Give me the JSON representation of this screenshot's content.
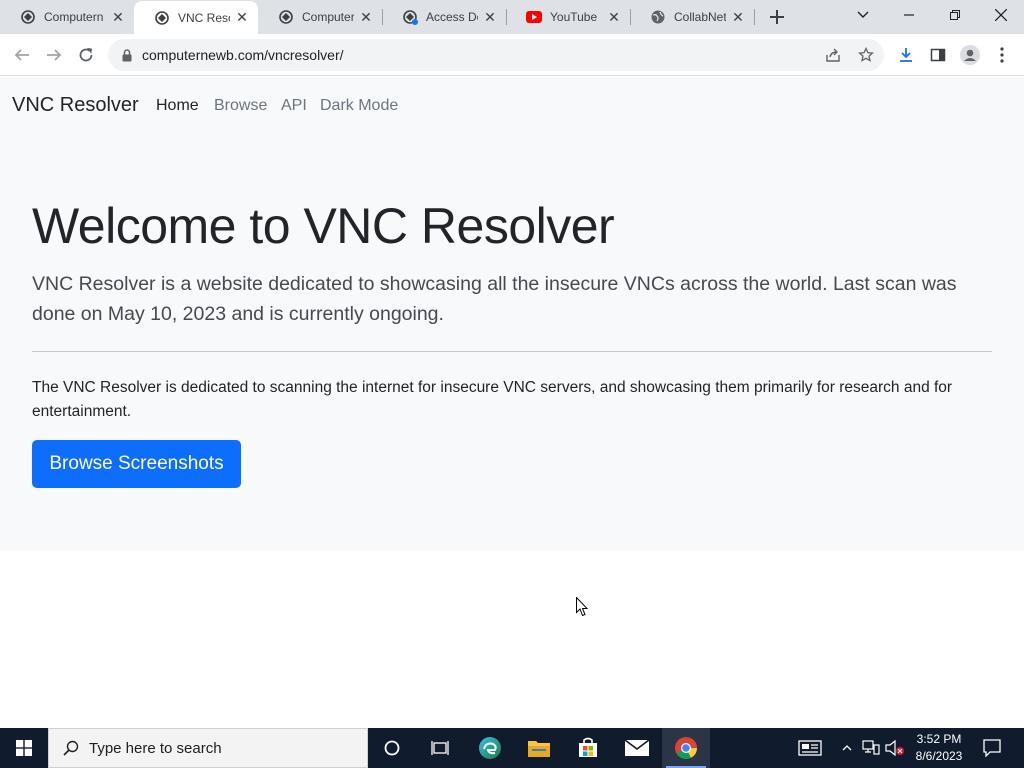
{
  "browser": {
    "tabs": [
      {
        "title": "Computern",
        "favicon": "computernewb-icon",
        "active": false
      },
      {
        "title": "VNC Resolv",
        "favicon": "computernewb-icon",
        "active": true
      },
      {
        "title": "Computern",
        "favicon": "computernewb-icon",
        "active": false
      },
      {
        "title": "Access Den",
        "favicon": "computernewb-icon",
        "active": false
      },
      {
        "title": "YouTube",
        "favicon": "youtube-icon",
        "active": false
      },
      {
        "title": "CollabNet",
        "favicon": "globe-icon",
        "active": false
      }
    ],
    "url": "computernewb.com/vncresolver/"
  },
  "site": {
    "brand": "VNC Resolver",
    "nav": {
      "home": "Home",
      "browse": "Browse",
      "api": "API",
      "dark_mode": "Dark Mode"
    },
    "title": "Welcome to VNC Resolver",
    "lead": "VNC Resolver is a website dedicated to showcasing all the insecure VNCs across the world. Last scan was done on May 10, 2023 and is currently ongoing.",
    "description": "The VNC Resolver is dedicated to scanning the internet for insecure VNC servers, and showcasing them primarily for research and for entertainment.",
    "button": "Browse Screenshots"
  },
  "taskbar": {
    "search_placeholder": "Type here to search",
    "time": "3:52 PM",
    "date": "8/6/2023"
  },
  "colors": {
    "primary_button": "#0d6efd",
    "hero_background": "#f8f9fa",
    "taskbar": "#101b2d"
  }
}
